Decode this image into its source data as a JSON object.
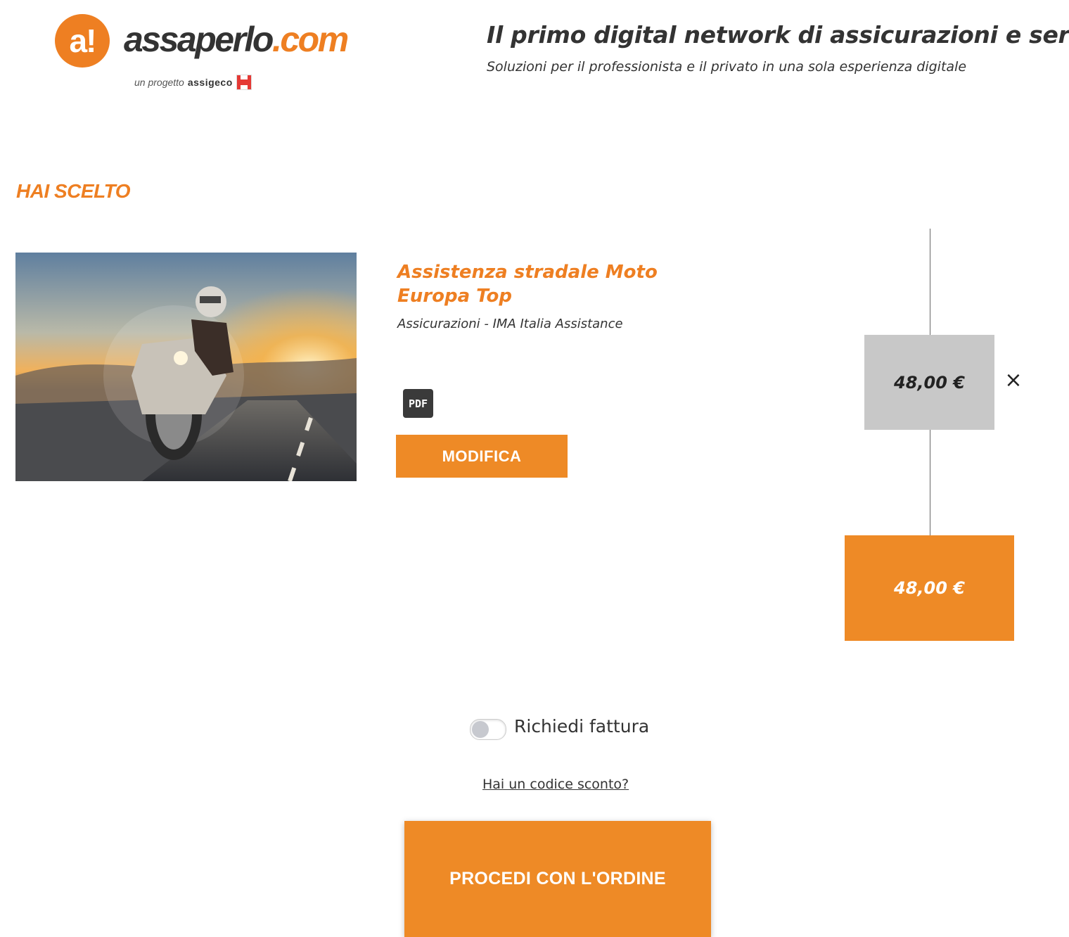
{
  "header": {
    "logo_mark": "a!",
    "logo_name": "assaperlo",
    "logo_tld": ".com",
    "logo_sub_prefix": "un progetto",
    "logo_sub_brand": "assigeco",
    "tagline": "Il primo digital network di assicurazioni e servizi",
    "tagline_sub": "Soluzioni per il professionista e il privato in una sola esperienza digitale"
  },
  "cart": {
    "section_title": "HAI SCELTO",
    "item": {
      "name": "Assistenza stradale Moto Europa Top",
      "provider": "Assicurazioni - IMA Italia Assistance",
      "pdf_label": "PDF",
      "edit_button": "MODIFICA",
      "price": "48,00 €",
      "remove_icon": "×",
      "image_alt": "Moto su strada al tramonto"
    },
    "total": "48,00 €"
  },
  "checkout": {
    "invoice_label": "Richiedi fattura",
    "invoice_enabled": false,
    "discount_link": "Hai un codice sconto?",
    "proceed_button": "PROCEDI CON L'ORDINE"
  },
  "colors": {
    "accent": "#ee8a26",
    "price_box": "#c8c8c8",
    "text": "#333333"
  }
}
